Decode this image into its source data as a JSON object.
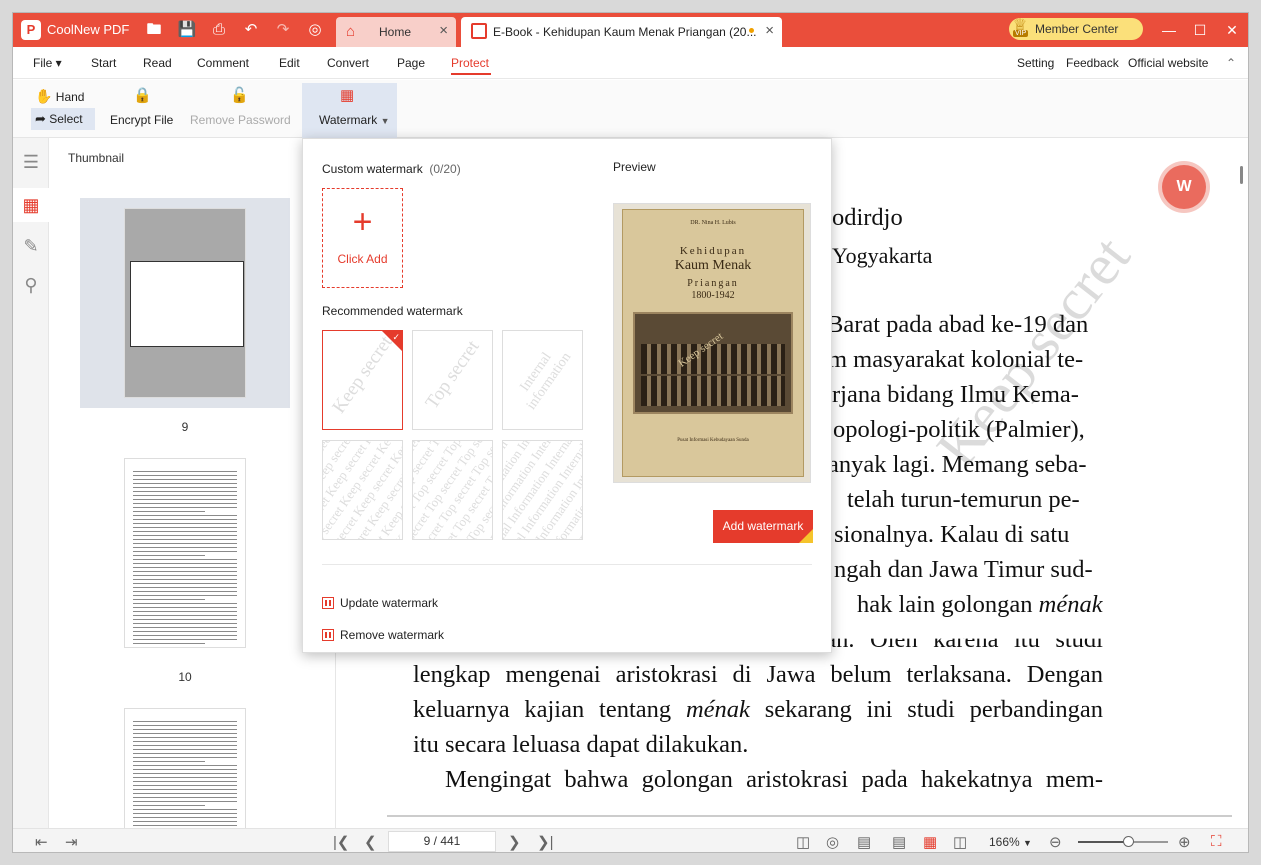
{
  "app": {
    "name": "CoolNew PDF",
    "logo_letter": "P",
    "accent_color": "#e53b2c"
  },
  "tabs": [
    {
      "label": "Home",
      "icon": "home-icon"
    },
    {
      "label": "E-Book - Kehidupan Kaum Menak Priangan (20...",
      "icon": "pdf-file-icon"
    }
  ],
  "member_center": {
    "label": "Member Center",
    "badge": "VIP"
  },
  "menu": {
    "file": "File",
    "items": [
      "Start",
      "Read",
      "Comment",
      "Edit",
      "Convert",
      "Page",
      "Protect"
    ],
    "active": "Protect",
    "right": [
      "Setting",
      "Feedback",
      "Official website"
    ]
  },
  "toolbar": {
    "hand": "Hand",
    "select": "Select",
    "encrypt_file": "Encrypt File",
    "remove_password": "Remove Password",
    "watermark": "Watermark"
  },
  "thumbnail_panel": {
    "title": "Thumbnail",
    "pages": [
      {
        "number": "9",
        "selected": true
      },
      {
        "number": "10",
        "selected": false
      },
      {
        "number": "",
        "selected": false
      }
    ]
  },
  "watermark_popup": {
    "custom_label": "Custom watermark",
    "custom_count": "(0/20)",
    "click_add": "Click Add",
    "recommended_label": "Recommended watermark",
    "cards": [
      {
        "text": "Keep secret",
        "style": "single",
        "selected": true
      },
      {
        "text": "Top secret",
        "style": "single",
        "selected": false
      },
      {
        "text": "Internal information",
        "style": "single",
        "selected": false
      },
      {
        "text": "Keep secret",
        "style": "tiled",
        "selected": false
      },
      {
        "text": "Top secret",
        "style": "tiled",
        "selected": false
      },
      {
        "text": "Internal Information",
        "style": "tiled",
        "selected": false
      }
    ],
    "preview_label": "Preview",
    "preview_book": {
      "author": "DR. Nina H. Lubis",
      "title_line1": "Kehidupan",
      "title_line2": "Kaum Menak",
      "title_line3": "Priangan",
      "years": "1800-1942",
      "watermark": "Keep secret",
      "publisher": "Pusat Informasi Kebudayaan Sunda"
    },
    "add_button": "Add watermark",
    "update": "Update watermark",
    "remove": "Remove watermark"
  },
  "document": {
    "heading_partial": "rtodirdjo",
    "subheading_partial": "Yogyakarta",
    "watermark_overlay": "Keep secret",
    "lines_right": [
      "Barat pada abad ke-19 dan",
      "m masyarakat kolonial te-",
      "rjana bidang Ilmu Kema-",
      "opologi-politik (Palmier),",
      "anyak lagi. Memang seba-",
      "telah turun-temurun pe-",
      "sionalnya. Kalau di satu",
      "ngah dan Jawa Timur sud-"
    ],
    "line_menak_pre": "hak lain golongan ",
    "line_menak_em": "ménak",
    "line_partial_hidden": "di Jawa Barat agak kurang diperhatikan. Oleh karena itu studi",
    "full_lines": [
      "lengkap mengenai aristokrasi di Jawa belum terlaksana. Dengan"
    ],
    "line_keluarnya_pre": "keluarnya kajian tentang ",
    "line_keluarnya_em": "ménak",
    "line_keluarnya_post": " sekarang ini studi perbandingan",
    "line_itu": "itu secara leluasa dapat dilakukan.",
    "line_mengingat": "Mengingat bahwa golongan aristokrasi pada hakekatnya mem-"
  },
  "statusbar": {
    "page_indicator": "9 / 441",
    "zoom": "166%",
    "zoom_level": 0.55
  }
}
